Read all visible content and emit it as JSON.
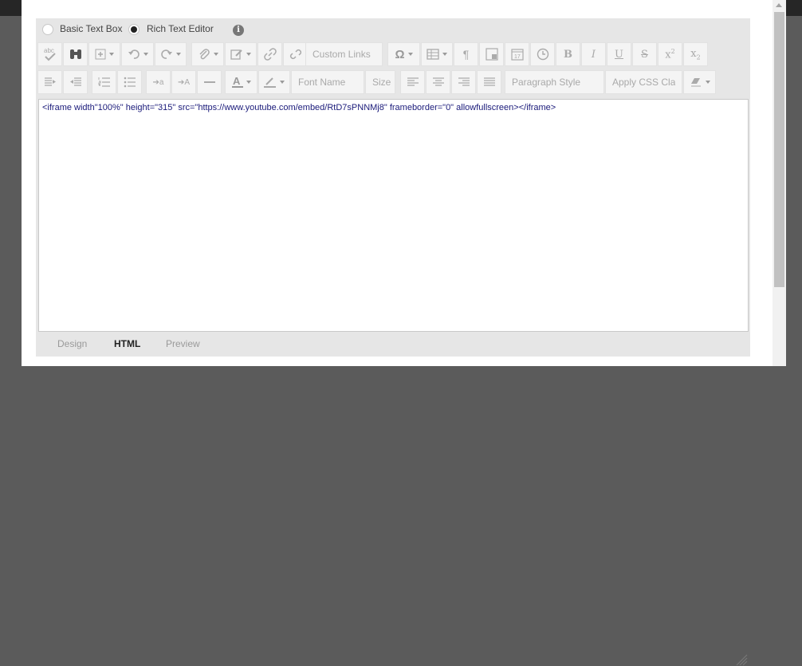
{
  "mode": {
    "basic_label": "Basic Text Box",
    "rich_label": "Rich Text Editor",
    "selected": "Rich Text Editor",
    "info_icon": "i"
  },
  "toolbar": {
    "row1": [
      {
        "name": "spellcheck-button",
        "icon": "spellcheck-icon"
      },
      {
        "name": "find-button",
        "icon": "binoculars-icon"
      },
      {
        "name": "insert-button",
        "icon": "plus-box-icon",
        "dropdown": true
      },
      {
        "name": "undo-button",
        "icon": "undo-icon",
        "dropdown": true
      },
      {
        "name": "redo-button",
        "icon": "redo-icon",
        "dropdown": true
      },
      {
        "name": "attach-button",
        "icon": "paperclip-icon",
        "dropdown": true
      },
      {
        "name": "edit-button",
        "icon": "pencil-icon",
        "dropdown": true
      },
      {
        "name": "link-button",
        "icon": "link-icon"
      },
      {
        "name": "unlink-button",
        "icon": "unlink-icon"
      },
      {
        "name": "custom-links-dropdown",
        "text": "Custom Links"
      },
      {
        "name": "special-char-button",
        "icon": "omega-icon",
        "dropdown": true
      },
      {
        "name": "table-button",
        "icon": "table-icon",
        "dropdown": true
      },
      {
        "name": "paragraph-marks-button",
        "icon": "pilcrow-icon"
      },
      {
        "name": "image-button",
        "icon": "image-icon"
      },
      {
        "name": "date-button",
        "icon": "calendar-icon"
      },
      {
        "name": "time-button",
        "icon": "clock-icon"
      },
      {
        "name": "bold-button",
        "text": "B"
      },
      {
        "name": "italic-button",
        "text": "I"
      },
      {
        "name": "underline-button",
        "text": "U"
      },
      {
        "name": "strikethrough-button",
        "text": "S"
      },
      {
        "name": "superscript-button",
        "text": "x2"
      },
      {
        "name": "subscript-button",
        "text": "x2"
      }
    ],
    "row2": [
      {
        "name": "indent-button",
        "icon": "indent-icon"
      },
      {
        "name": "outdent-button",
        "icon": "outdent-icon"
      },
      {
        "name": "ordered-list-button",
        "icon": "ordered-list-icon"
      },
      {
        "name": "bullet-list-button",
        "icon": "bullet-list-icon"
      },
      {
        "name": "decrease-font-button",
        "icon": "decrease-font-icon"
      },
      {
        "name": "increase-font-button",
        "icon": "increase-font-icon"
      },
      {
        "name": "horizontal-rule-button",
        "icon": "horizontal-rule-icon"
      },
      {
        "name": "font-color-button",
        "icon": "font-color-icon",
        "dropdown": true
      },
      {
        "name": "highlight-button",
        "icon": "highlighter-icon",
        "dropdown": true
      },
      {
        "name": "font-name-dropdown",
        "text": "Font Name"
      },
      {
        "name": "font-size-dropdown",
        "text": "Size"
      },
      {
        "name": "align-left-button",
        "icon": "align-left-icon"
      },
      {
        "name": "align-center-button",
        "icon": "align-center-icon"
      },
      {
        "name": "align-right-button",
        "icon": "align-right-icon"
      },
      {
        "name": "justify-button",
        "icon": "justify-icon"
      },
      {
        "name": "paragraph-style-dropdown",
        "text": "Paragraph Style"
      },
      {
        "name": "css-class-dropdown",
        "text": "Apply CSS Cla"
      },
      {
        "name": "eraser-button",
        "icon": "eraser-icon",
        "dropdown": true
      }
    ]
  },
  "content": {
    "html_source": "<iframe width\"100%\" height=\"315\" src=\"https://www.youtube.com/embed/RtD7sPNNMj8\" frameborder=\"0\" allowfullscreen></iframe>"
  },
  "tabs": [
    {
      "label": "Design",
      "active": false
    },
    {
      "label": "HTML",
      "active": true
    },
    {
      "label": "Preview",
      "active": false
    }
  ]
}
